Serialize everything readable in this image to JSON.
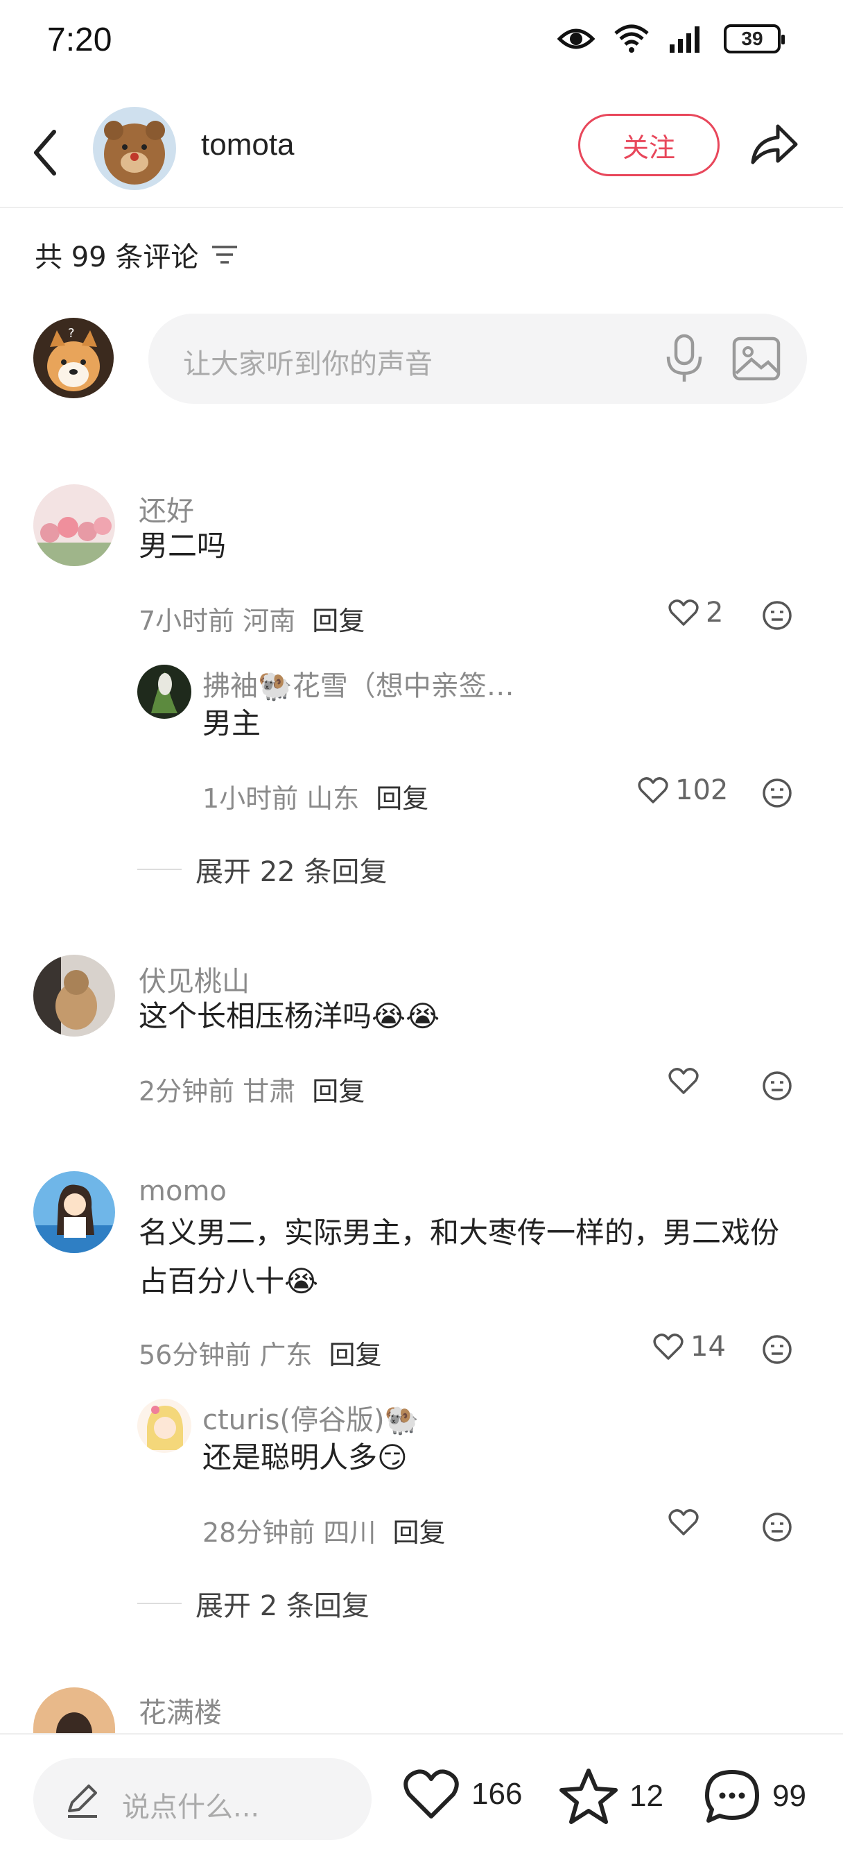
{
  "status_bar": {
    "time": "7:20",
    "battery": "39"
  },
  "header": {
    "author_name": "tomota",
    "follow_label": "关注"
  },
  "comment_section": {
    "count_label": "共 99 条评论"
  },
  "comment_input": {
    "placeholder": "让大家听到你的声音"
  },
  "comments": [
    {
      "user": "还好",
      "text": "男二吗",
      "time": "7小时前 河南",
      "reply_label": "回复",
      "likes": "2",
      "sub_reply": {
        "user": "拂袖🐏花雪（想中亲签…",
        "text": "男主",
        "time": "1小时前 山东",
        "reply_label": "回复",
        "likes": "102"
      },
      "expand_label": "展开 22 条回复"
    },
    {
      "user": "伏见桃山",
      "text": "这个长相压杨洋吗😭😭",
      "time": "2分钟前 甘肃",
      "reply_label": "回复",
      "likes": ""
    },
    {
      "user": "momo",
      "text": "名义男二，实际男主，和大枣传一样的，男二戏份占百分八十😭",
      "time": "56分钟前 广东",
      "reply_label": "回复",
      "likes": "14",
      "sub_reply": {
        "user": "cturis(停谷版)🐏",
        "text": "还是聪明人多😏",
        "time": "28分钟前 四川",
        "reply_label": "回复",
        "likes": ""
      },
      "expand_label": "展开 2 条回复"
    },
    {
      "user": "花满楼"
    }
  ],
  "bottom_bar": {
    "input_placeholder": "说点什么...",
    "likes": "166",
    "favorites": "12",
    "comments": "99"
  },
  "colors": {
    "accent": "#e8475b",
    "muted": "#8a8a8a",
    "input_bg": "#f4f4f5"
  }
}
